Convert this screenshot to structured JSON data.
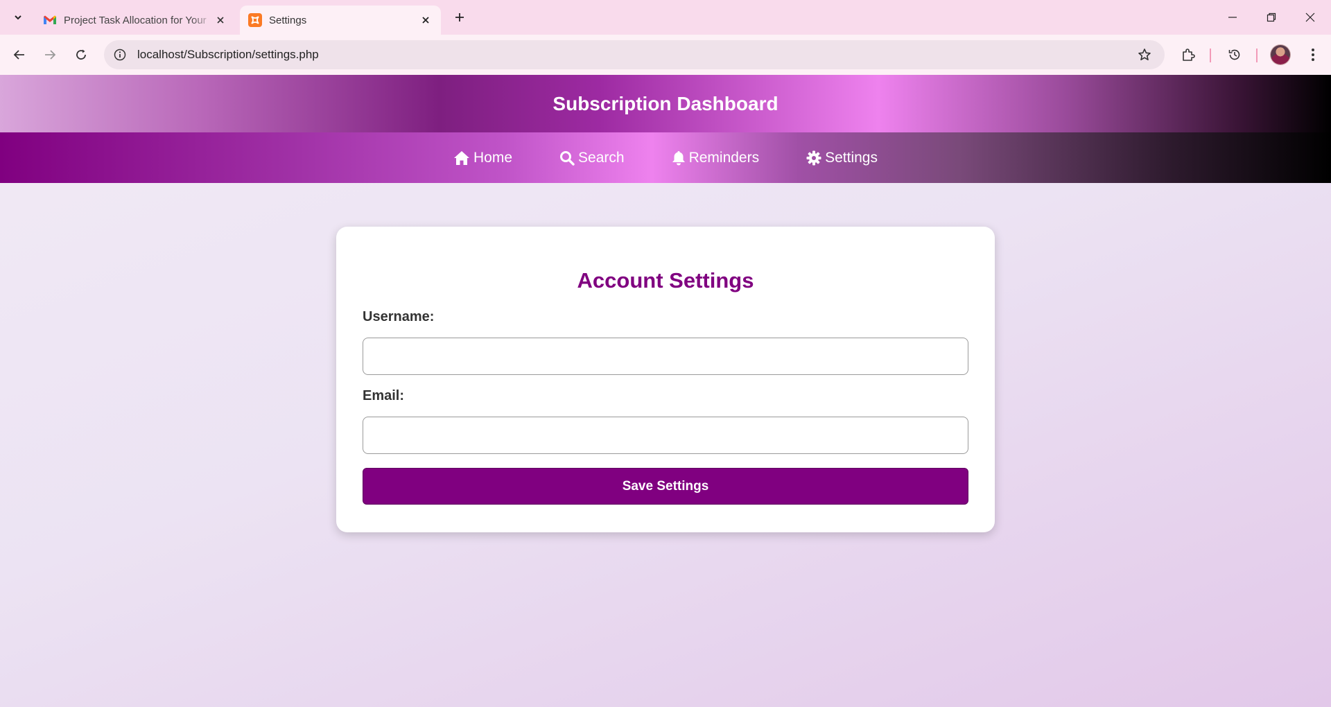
{
  "browser": {
    "tabs": [
      {
        "title": "Project Task Allocation for Your",
        "icon": "gmail-icon",
        "active": false
      },
      {
        "title": "Settings",
        "icon": "xampp-icon",
        "active": true
      }
    ],
    "url": "localhost/Subscription/settings.php"
  },
  "header": {
    "title": "Subscription Dashboard"
  },
  "nav": {
    "items": [
      {
        "label": "Home",
        "icon": "home-icon"
      },
      {
        "label": "Search",
        "icon": "search-icon"
      },
      {
        "label": "Reminders",
        "icon": "bell-icon"
      },
      {
        "label": "Settings",
        "icon": "gear-icon"
      }
    ]
  },
  "settings_form": {
    "title": "Account Settings",
    "username_label": "Username:",
    "username_value": "",
    "email_label": "Email:",
    "email_value": "",
    "save_label": "Save Settings"
  },
  "colors": {
    "accent": "#800080",
    "nav_highlight": "#ee82ee"
  }
}
